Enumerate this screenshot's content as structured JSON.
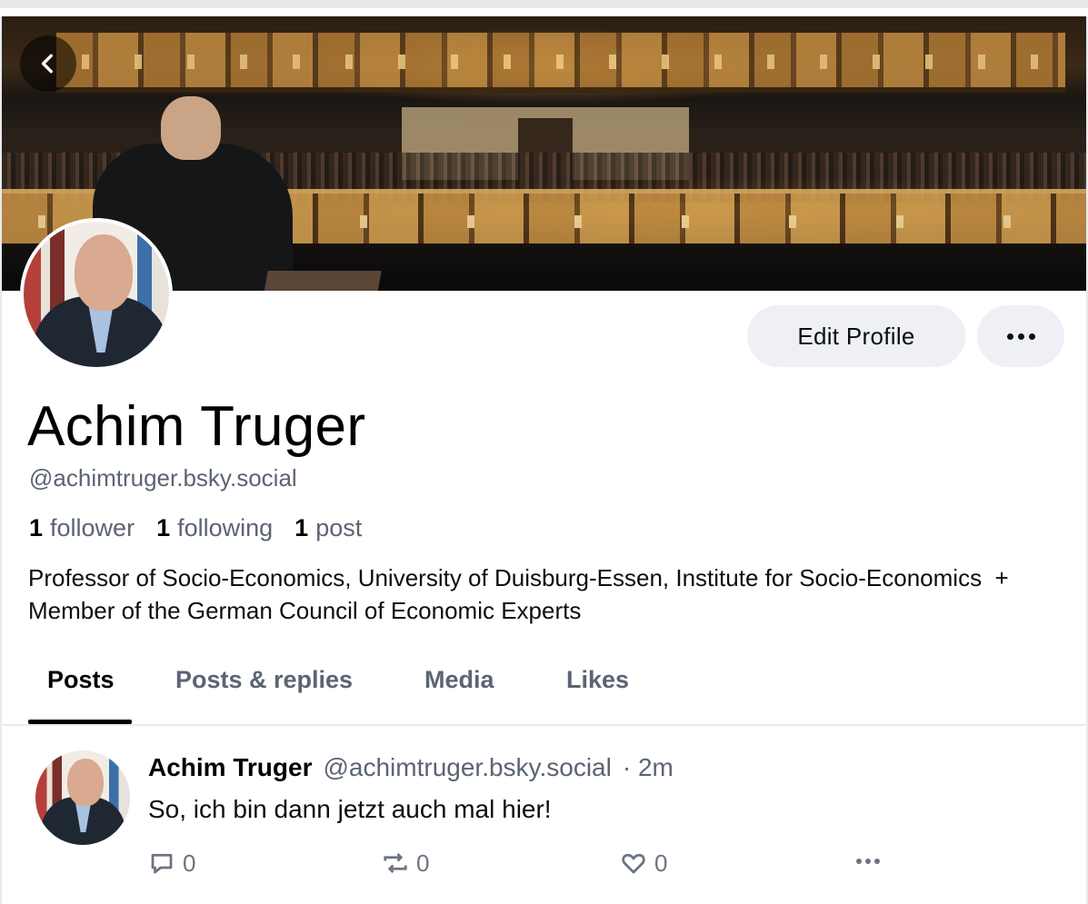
{
  "profile": {
    "display_name": "Achim Truger",
    "handle": "@achimtruger.bsky.social",
    "stats": {
      "followers_count": "1",
      "followers_label": "follower",
      "following_count": "1",
      "following_label": "following",
      "posts_count": "1",
      "posts_label": "post"
    },
    "bio": "Professor of Socio-Economics, University of Duisburg-Essen, Institute for Socio-Economics  + Member of the German Council of Economic Experts",
    "edit_label": "Edit Profile"
  },
  "tabs": [
    {
      "label": "Posts",
      "active": true
    },
    {
      "label": "Posts & replies",
      "active": false
    },
    {
      "label": "Media",
      "active": false
    },
    {
      "label": "Likes",
      "active": false
    }
  ],
  "post": {
    "author_name": "Achim Truger",
    "author_handle": "@achimtruger.bsky.social",
    "time": "· 2m",
    "text": "So, ich bin dann jetzt auch mal hier!",
    "reply_count": "0",
    "repost_count": "0",
    "like_count": "0"
  },
  "icons": {
    "back": "chevron-left-icon",
    "more": "ellipsis-icon",
    "reply": "speech-bubble-icon",
    "repost": "repost-arrows-icon",
    "like": "heart-icon"
  },
  "colors": {
    "secondary_text": "#5b6472",
    "button_bg": "#eef0f5",
    "divider": "#e8eaee"
  }
}
